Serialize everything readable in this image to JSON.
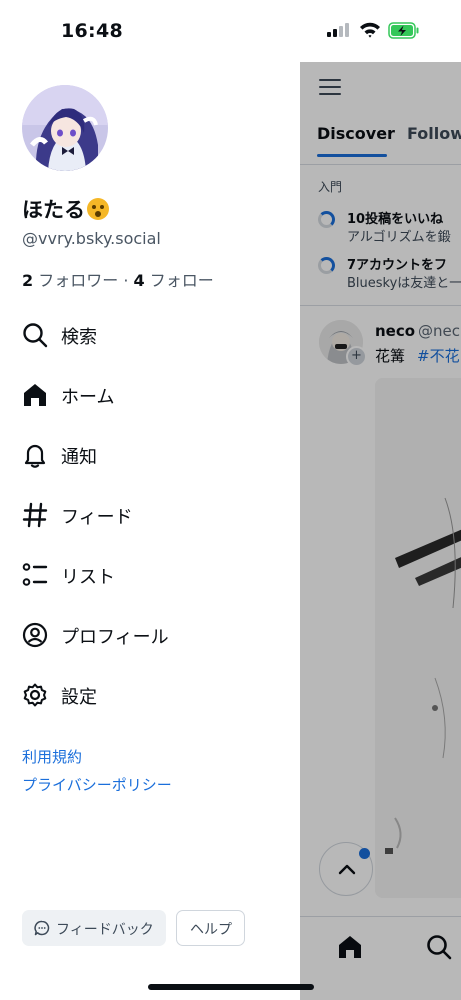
{
  "status_bar": {
    "time": "16:48",
    "icons": [
      "cellular-signal-icon",
      "wifi-icon",
      "battery-charging-icon"
    ],
    "battery_color": "#34c759"
  },
  "drawer": {
    "display_name": "ほたる",
    "display_name_emoji": "astonished-face-emoji",
    "handle": "@vvry.bsky.social",
    "followers_count": "2",
    "followers_label": "フォロワー",
    "separator": " · ",
    "following_count": "4",
    "following_label": "フォロー",
    "nav": [
      {
        "label": "検索",
        "icon": "search-icon"
      },
      {
        "label": "ホーム",
        "icon": "home-icon"
      },
      {
        "label": "通知",
        "icon": "bell-icon"
      },
      {
        "label": "フィード",
        "icon": "hashtag-icon"
      },
      {
        "label": "リスト",
        "icon": "list-icon"
      },
      {
        "label": "プロフィール",
        "icon": "profile-icon"
      },
      {
        "label": "設定",
        "icon": "gear-icon"
      }
    ],
    "links": {
      "terms": "利用規約",
      "privacy": "プライバシーポリシー"
    },
    "feedback_label": "フィードバック",
    "help_label": "ヘルプ"
  },
  "feed": {
    "tabs": [
      "Discover",
      "Followi"
    ],
    "section_label": "入門",
    "tasks": [
      {
        "title": "10投稿をいいね",
        "subtitle": "アルゴリズムを鍛"
      },
      {
        "title": "7アカウントをフ",
        "subtitle": "Blueskyは友達と一"
      }
    ],
    "post": {
      "author": "neco",
      "handle": "@nec",
      "text": "花篝",
      "tag": "#不花"
    }
  },
  "colors": {
    "accent": "#1b6fdb",
    "text": "#0b0f14",
    "muted": "#4a5663"
  }
}
